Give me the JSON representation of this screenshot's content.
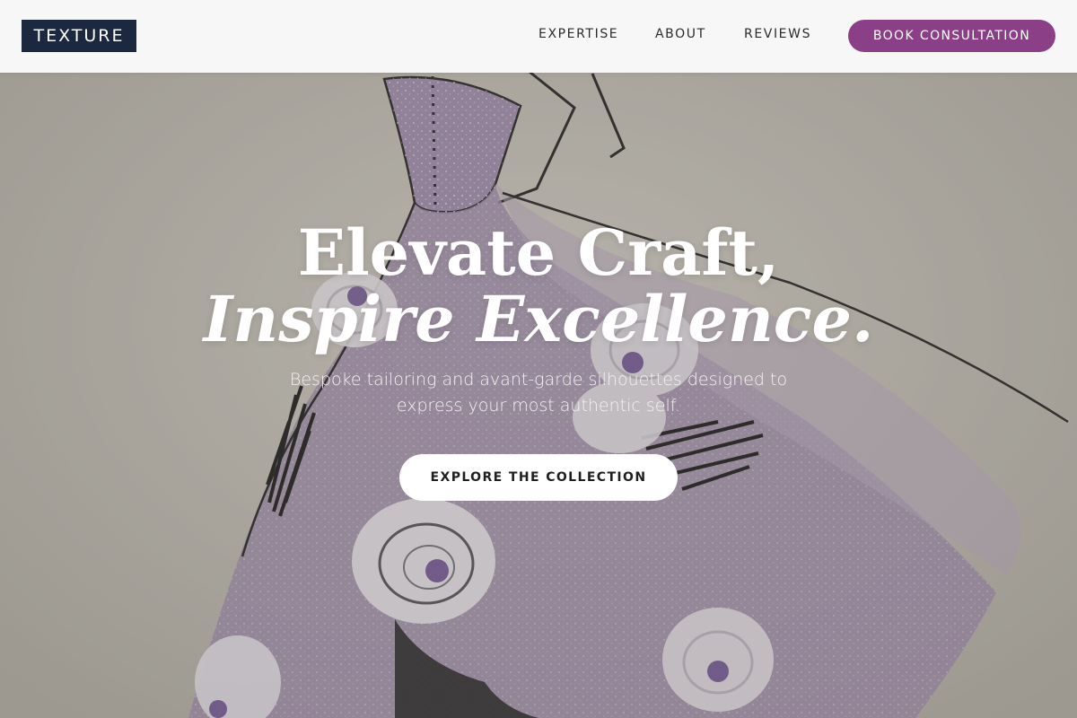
{
  "header": {
    "logo": "TEXTURE",
    "nav": {
      "expertise": "EXPERTISE",
      "about": "ABOUT",
      "reviews": "REVIEWS"
    },
    "cta": "BOOK CONSULTATION"
  },
  "hero": {
    "title_line1": "Elevate Craft,",
    "title_line2": "Inspire Excellence.",
    "subtitle": "Bespoke tailoring and avant-garde silhouettes designed to express your most authentic self.",
    "cta": "EXPLORE THE COLLECTION",
    "background": "fashion-sketch-illustration"
  },
  "colors": {
    "brand_navy": "#1c2740",
    "accent_purple": "#8a3f87",
    "header_bg": "#f7f7f7",
    "dress_lavender": "#9a86a8"
  }
}
